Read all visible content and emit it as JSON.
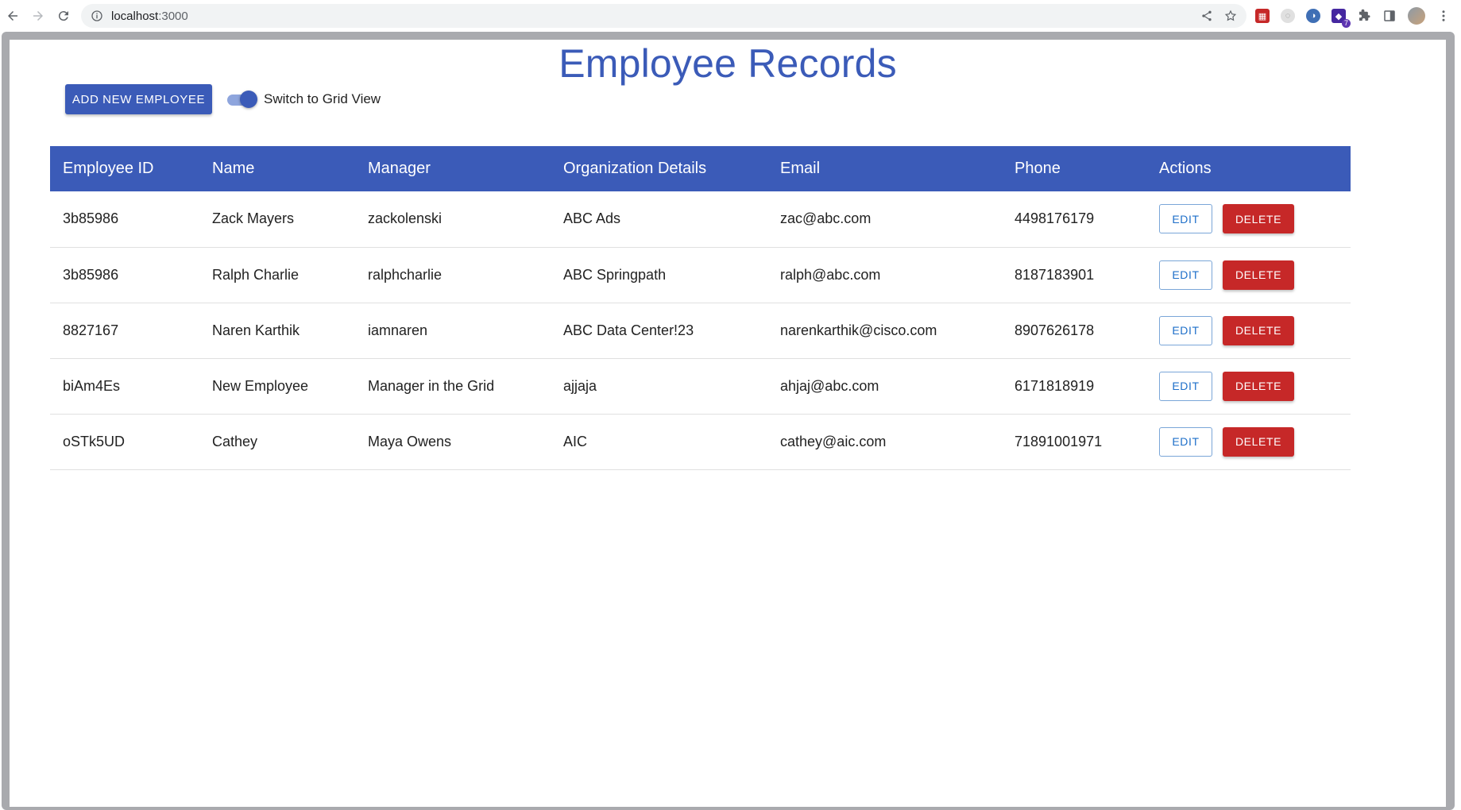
{
  "browser": {
    "url_host": "localhost",
    "url_port": ":3000",
    "extension_badge": "7"
  },
  "app": {
    "title": "Employee Records",
    "add_button_label": "ADD NEW EMPLOYEE",
    "toggle_label": "Switch to Grid View",
    "toggle_on": true
  },
  "table": {
    "headers": [
      "Employee ID",
      "Name",
      "Manager",
      "Organization Details",
      "Email",
      "Phone",
      "Actions"
    ],
    "rows": [
      {
        "id": "3b85986",
        "name": "Zack Mayers",
        "manager": "zackolenski",
        "org": "ABC Ads",
        "email": "zac@abc.com",
        "phone": "4498176179",
        "edit": "EDIT",
        "delete": "DELETE"
      },
      {
        "id": "3b85986",
        "name": "Ralph Charlie",
        "manager": "ralphcharlie",
        "org": "ABC Springpath",
        "email": "ralph@abc.com",
        "phone": "8187183901",
        "edit": "EDIT",
        "delete": "DELETE"
      },
      {
        "id": "8827167",
        "name": "Naren Karthik",
        "manager": "iamnaren",
        "org": "ABC Data Center!23",
        "email": "narenkarthik@cisco.com",
        "phone": "8907626178",
        "edit": "EDIT",
        "delete": "DELETE"
      },
      {
        "id": "biAm4Es",
        "name": "New Employee",
        "manager": "Manager in the Grid",
        "org": "ajjaja",
        "email": "ahjaj@abc.com",
        "phone": "6171818919",
        "edit": "EDIT",
        "delete": "DELETE"
      },
      {
        "id": "oSTk5UD",
        "name": "Cathey",
        "manager": "Maya Owens",
        "org": "AIC",
        "email": "cathey@aic.com",
        "phone": "71891001971",
        "edit": "EDIT",
        "delete": "DELETE"
      }
    ]
  },
  "colors": {
    "primary": "#3b5bb8",
    "danger": "#c62828",
    "edit_text": "#1e6fc9"
  }
}
